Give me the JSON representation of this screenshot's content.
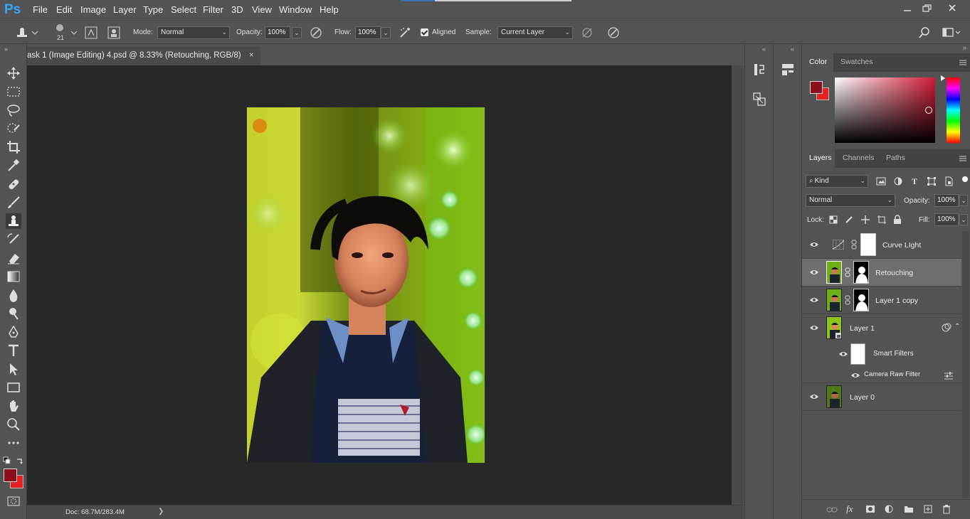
{
  "app": {
    "logo": "Ps"
  },
  "menu": [
    "File",
    "Edit",
    "Image",
    "Layer",
    "Type",
    "Select",
    "Filter",
    "3D",
    "View",
    "Window",
    "Help"
  ],
  "options": {
    "brush_size": "21",
    "mode_label": "Mode:",
    "mode_value": "Normal",
    "opacity_label": "Opacity:",
    "opacity_value": "100%",
    "flow_label": "Flow:",
    "flow_value": "100%",
    "aligned_label": "Aligned",
    "sample_label": "Sample:",
    "sample_value": "Current Layer"
  },
  "document": {
    "tab_title": "ask 1 (Image Editing) 4.psd @ 8.33% (Retouching, RGB/8)",
    "close": "×",
    "status": "Doc: 68.7M/283.4M",
    "status_arrow": "❯"
  },
  "color_panel": {
    "tabs": [
      "Color",
      "Swatches"
    ],
    "foreground": "#8e0e1c",
    "background": "#e52222"
  },
  "layers_panel": {
    "tabs": [
      "Layers",
      "Channels",
      "Paths"
    ],
    "filter_kind": "Kind",
    "blend_mode": "Normal",
    "opacity_label": "Opacity:",
    "opacity_value": "100%",
    "lock_label": "Lock:",
    "fill_label": "Fill:",
    "fill_value": "100%",
    "layers": [
      {
        "name": "Curve LIght"
      },
      {
        "name": "Retouching"
      },
      {
        "name": "Layer 1 copy"
      },
      {
        "name": "Layer 1"
      },
      {
        "name": "Smart Filters"
      },
      {
        "name": "Camera Raw Filter"
      },
      {
        "name": "Layer 0"
      }
    ],
    "selected_layer": "Retouching"
  }
}
